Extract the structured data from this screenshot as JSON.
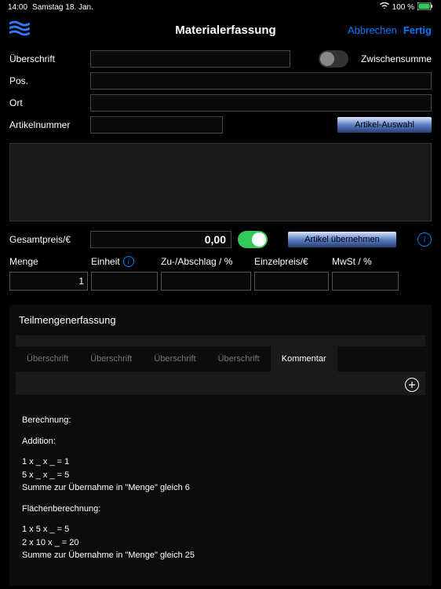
{
  "status": {
    "time": "14:00",
    "date": "Samstag 18. Jan.",
    "battery": "100 %"
  },
  "nav": {
    "title": "Materialerfassung",
    "cancel": "Abbrechen",
    "done": "Fertig"
  },
  "form": {
    "heading_label": "Überschrift",
    "pos_label": "Pos.",
    "ort_label": "Ort",
    "article_number_label": "Artikelnummer",
    "subtotal_toggle_label": "Zwischensumme",
    "article_select_btn": "Artikel-Auswahl",
    "total_price_label": "Gesamtpreis/€",
    "total_price_value": "0,00",
    "adopt_btn": "Artikel übernehmen"
  },
  "grid": {
    "headers": {
      "menge": "Menge",
      "einheit": "Einheit",
      "zuschlag": "Zu-/Abschlag / %",
      "einzelpreis": "Einzelpreis/€",
      "mwst": "MwSt / %"
    },
    "values": {
      "menge": "1",
      "einheit": "",
      "zuschlag": "",
      "einzelpreis": "",
      "mwst": ""
    }
  },
  "sub": {
    "title": "Teilmengenerfassung",
    "tab1": "Überschrift",
    "tab2": "Überschrift",
    "tab3": "Überschrift",
    "tab4": "Überschrift",
    "tab5": "Kommentar"
  },
  "calc": {
    "title": "Berechnung:",
    "add_title": "Addition:",
    "add_line1": "1 x _ x _ = 1",
    "add_line2": "5 x _ x _ = 5",
    "add_sum": "Summe zur Übernahme in \"Menge\" gleich 6",
    "area_title": "Flächenberechnung:",
    "area_line1": "1 x 5 x _ = 5",
    "area_line2": "2 x 10 x _ = 20",
    "area_sum": "Summe zur Übernahme in \"Menge\" gleich 25"
  }
}
